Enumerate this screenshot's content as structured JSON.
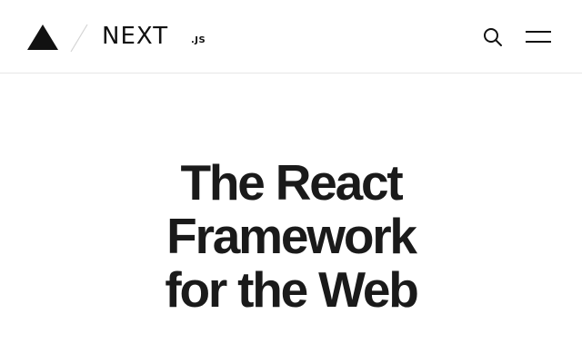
{
  "header": {
    "brand_name": "NEXT",
    "brand_suffix": ".JS",
    "logo_icon": "triangle-logo-icon",
    "search_icon": "search-icon",
    "menu_icon": "hamburger-menu-icon"
  },
  "hero": {
    "title_lines": [
      "The React",
      "Framework",
      "for the Web"
    ]
  },
  "colors": {
    "background": "#ffffff",
    "text": "#111111",
    "border": "#e6e6e6"
  }
}
